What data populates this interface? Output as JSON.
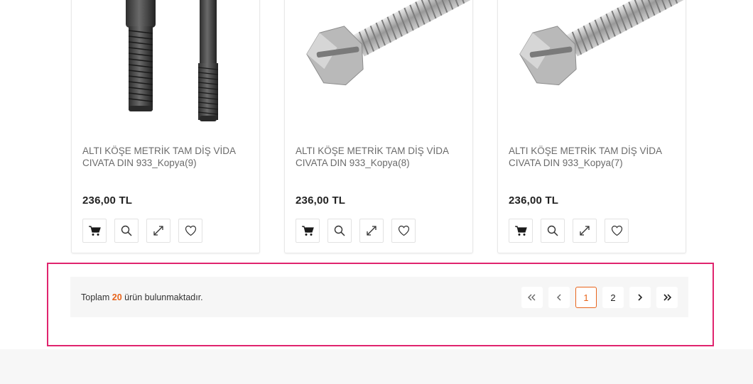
{
  "products": [
    {
      "name": "ALTI KÖŞE METRİK TAM DİŞ VİDA CIVATA DIN 933_Kopya(9)",
      "price": "236,00 TL",
      "image": "allen-bolt-image"
    },
    {
      "name": "ALTI KÖŞE METRİK TAM DİŞ VİDA CIVATA DIN 933_Kopya(8)",
      "price": "236,00 TL",
      "image": "hex-bolt-image"
    },
    {
      "name": "ALTI KÖŞE METRİK TAM DİŞ VİDA CIVATA DIN 933_Kopya(7)",
      "price": "236,00 TL",
      "image": "hex-bolt-image"
    }
  ],
  "actions": [
    "cart-icon",
    "search-icon",
    "compare-icon",
    "heart-icon"
  ],
  "pagination": {
    "total_prefix": "Toplam",
    "total_count": "20",
    "total_suffix": "ürün bulunmaktadır.",
    "pages": [
      "1",
      "2"
    ],
    "current_page": "1"
  },
  "colors": {
    "accent": "#e8641b",
    "highlight": "#e0246e"
  }
}
